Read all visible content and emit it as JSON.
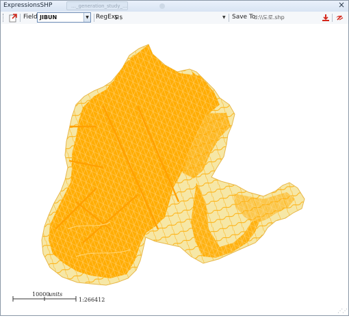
{
  "window": {
    "title": "ExpressionsSHP",
    "background_tab": "…_generation_study_…"
  },
  "toolbar": {
    "field_label": "Field",
    "field_value": "JIBUN",
    "regexp_label": "RegExp",
    "regexp_value": "도$",
    "save_to_label": "Save To",
    "save_path": "d:\\\\도로.shp"
  },
  "map": {
    "fill_light": "#f6e7a6",
    "fill_dense": "#ffad05",
    "outline": "#e8b84a",
    "scale_label": "10000",
    "scale_units": "units",
    "scale_ratio": "1:266412"
  },
  "icons": {
    "open": "open-shapefile-icon",
    "save": "save-icon",
    "run": "run-icon",
    "close": "close-icon"
  }
}
